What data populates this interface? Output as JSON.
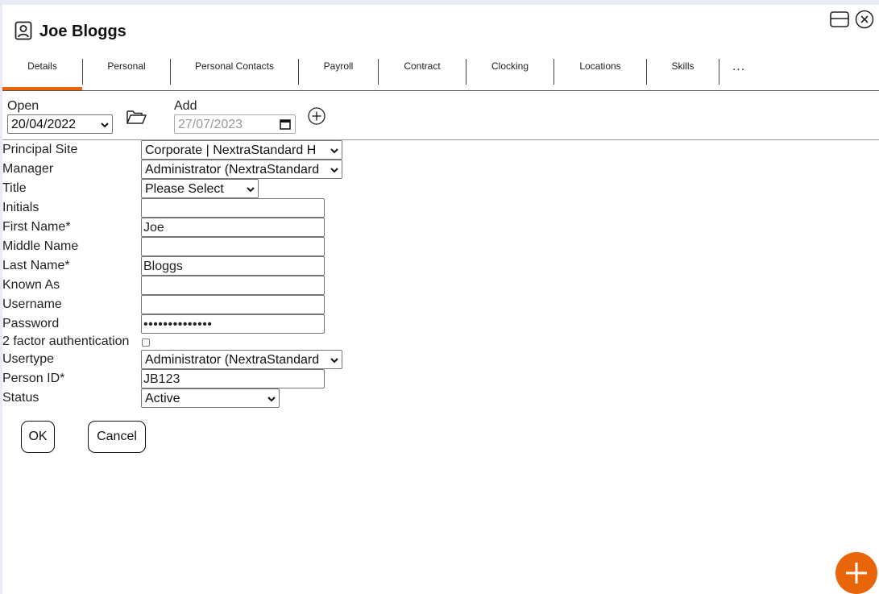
{
  "header": {
    "title": "Joe Bloggs"
  },
  "tabs": [
    "Details",
    "Personal",
    "Personal Contacts",
    "Payroll",
    "Contract",
    "Clocking",
    "Locations",
    "Skills",
    "..."
  ],
  "version": {
    "open_label": "Open",
    "open_value": "20/04/2022",
    "add_label": "Add",
    "add_value": "27/07/2023"
  },
  "form": {
    "principal_site": {
      "label": "Principal Site",
      "value": "Corporate | NextraStandard H"
    },
    "manager": {
      "label": "Manager",
      "value": "Administrator (NextraStandard"
    },
    "title": {
      "label": "Title",
      "value": "Please Select"
    },
    "initials": {
      "label": "Initials",
      "value": ""
    },
    "first_name": {
      "label": "First Name*",
      "value": "Joe"
    },
    "middle_name": {
      "label": "Middle Name",
      "value": ""
    },
    "last_name": {
      "label": "Last Name*",
      "value": "Bloggs"
    },
    "known_as": {
      "label": "Known As",
      "value": ""
    },
    "username": {
      "label": "Username",
      "value": ""
    },
    "password": {
      "label": "Password",
      "value": "••••••••••••••"
    },
    "two_factor": {
      "label": "2 factor authentication",
      "checked": false
    },
    "usertype": {
      "label": "Usertype",
      "value": "Administrator (NextraStandard"
    },
    "person_id": {
      "label": "Person ID*",
      "value": "JB123"
    },
    "status": {
      "label": "Status",
      "value": "Active"
    }
  },
  "buttons": {
    "ok": "OK",
    "cancel": "Cancel"
  },
  "colors": {
    "accent": "#e8650a",
    "background": "#e8ebf5",
    "panel": "#ffffff"
  },
  "icons": [
    "user-card-icon",
    "window-layout-icon",
    "close-circle-icon",
    "folder-open-icon",
    "add-circle-icon",
    "calendar-icon",
    "plus-icon"
  ]
}
